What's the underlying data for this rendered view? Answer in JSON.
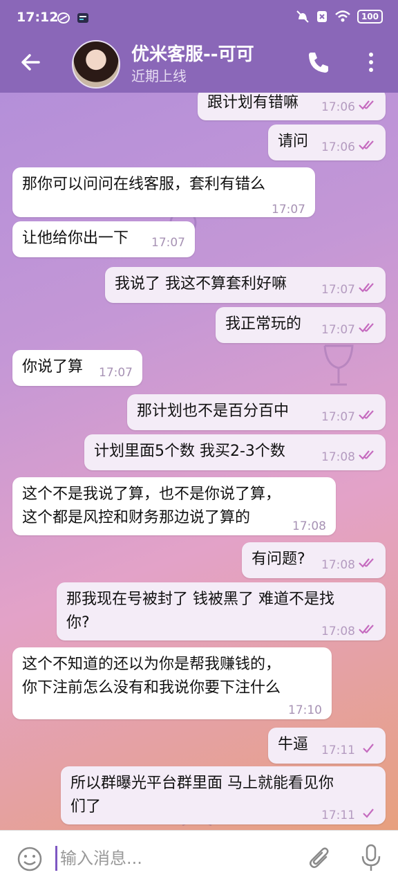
{
  "status": {
    "time": "17:12",
    "battery": "100"
  },
  "header": {
    "title": "优米客服--可可",
    "subtitle": "近期上线"
  },
  "messages": [
    {
      "text": "跟计划有错嘛",
      "time": "17:06"
    },
    {
      "text": "请问",
      "time": "17:06"
    },
    {
      "text": "那你可以问问在线客服，套利有错么",
      "time": "17:07"
    },
    {
      "text": "让他给你出一下",
      "time": "17:07"
    },
    {
      "text": "我说了 我这不算套利好嘛",
      "time": "17:07"
    },
    {
      "text": "我正常玩的",
      "time": "17:07"
    },
    {
      "text": "你说了算",
      "time": "17:07"
    },
    {
      "text": "那计划也不是百分百中",
      "time": "17:07"
    },
    {
      "text": "计划里面5个数  我买2-3个数",
      "time": "17:08"
    },
    {
      "line1": "这个不是我说了算，也不是你说了算，",
      "line2": "这个都是风控和财务那边说了算的",
      "time": "17:08"
    },
    {
      "text": "有问题?",
      "time": "17:08"
    },
    {
      "line1": "那我现在号被封了 钱被黑了 难道不是找",
      "line2": "你?",
      "time": "17:08"
    },
    {
      "line1": "这个不知道的还以为你是帮我赚钱的，",
      "line2": "你下注前怎么没有和我说你要下注什么",
      "time": "17:10"
    },
    {
      "text": "牛逼",
      "time": "17:11"
    },
    {
      "line1": "所以群曝光平台群里面 马上就能看见你",
      "line2": "们了",
      "time": "17:11"
    }
  ],
  "composer": {
    "placeholder": "输入消息..."
  }
}
